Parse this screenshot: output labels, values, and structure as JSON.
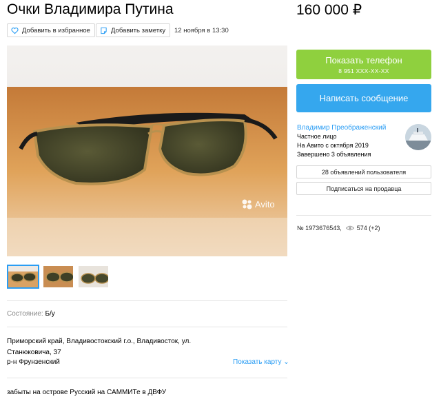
{
  "listing": {
    "title": "Очки Владимира Путина",
    "price": "160 000 ₽",
    "actions": {
      "favorite": "Добавить в избранное",
      "note": "Добавить заметку"
    },
    "date": "12 ноября в 13:30"
  },
  "photo": {
    "watermark": "Avito",
    "thumb_count": 3,
    "selected_thumb": 1
  },
  "details": {
    "condition_label": "Состояние:",
    "condition_value": "Б/у",
    "address": "Приморский край, Владивостокский г.о., Владивосток, ул. Станюковича, 37",
    "district": "р-н Фрунзенский",
    "show_map": "Показать карту",
    "description": "забыты на острове Русский на САММИТе в ДВФУ"
  },
  "contact": {
    "phone_label": "Показать телефон",
    "phone_masked": "8 951 XXX-XX-XX",
    "message_label": "Написать сообщение",
    "phone_color": "#8fd03e",
    "message_color": "#35a7ee"
  },
  "seller": {
    "name": "Владимир Преображенский",
    "type": "Частное лицо",
    "since": "На Авито с октября 2019",
    "completed": "Завершено 3 объявления",
    "user_ads": "28 объявлений пользователя",
    "subscribe": "Подписаться на продавца"
  },
  "meta": {
    "ad_number": "№ 1973676543,",
    "views": "574 (+2)"
  },
  "colors": {
    "link": "#2a9df4"
  }
}
